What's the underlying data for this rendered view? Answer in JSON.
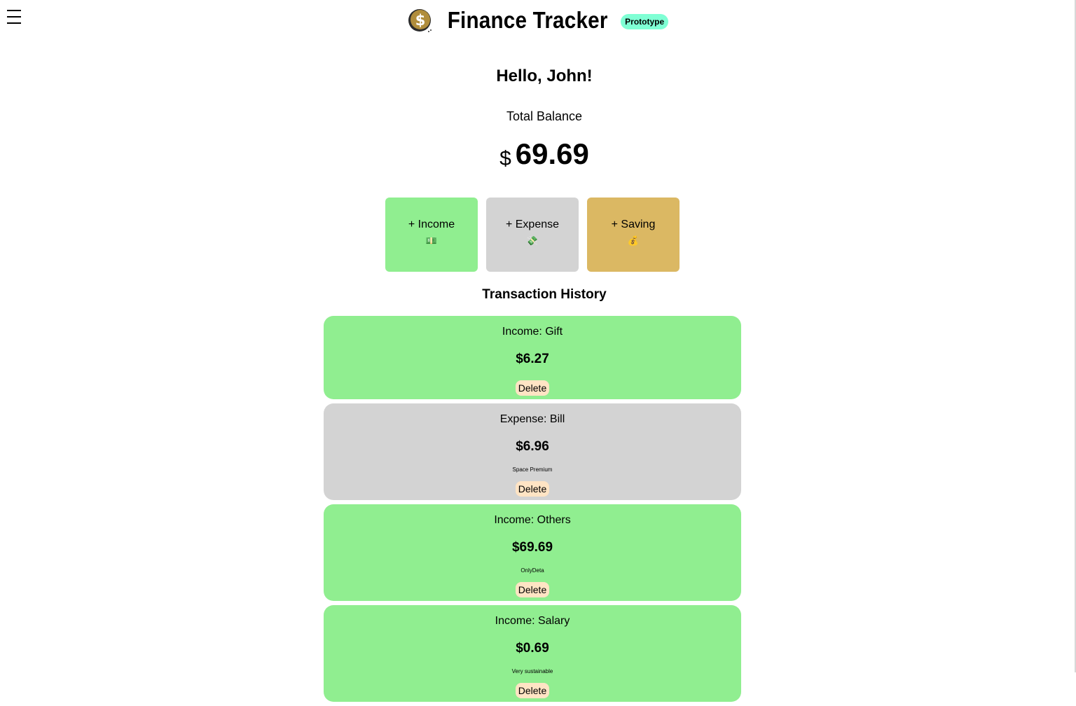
{
  "header": {
    "title": "Finance Tracker",
    "badge": "Prototype",
    "logo_icon": "dollar-coin-icon"
  },
  "greeting": "Hello, John!",
  "balance": {
    "label": "Total Balance",
    "currency": "$",
    "amount": "69.69"
  },
  "actions": [
    {
      "label": "+ Income",
      "emoji": "💵",
      "color": "#90ee90"
    },
    {
      "label": "+ Expense",
      "emoji": "💸",
      "color": "#d3d3d3"
    },
    {
      "label": "+ Saving",
      "emoji": "💰",
      "color": "#dbb863"
    }
  ],
  "history": {
    "title": "Transaction History",
    "transactions": [
      {
        "kind": "Income: Gift",
        "amount": "$6.27",
        "note": "",
        "delete_label": "Delete",
        "color": "#90ee90"
      },
      {
        "kind": "Expense: Bill",
        "amount": "$6.96",
        "note": "Space Premium",
        "delete_label": "Delete",
        "color": "#d3d3d3"
      },
      {
        "kind": "Income: Others",
        "amount": "$69.69",
        "note": "OnlyDeta",
        "delete_label": "Delete",
        "color": "#90ee90"
      },
      {
        "kind": "Income: Salary",
        "amount": "$0.69",
        "note": "Very sustainable",
        "delete_label": "Delete",
        "color": "#90ee90"
      }
    ]
  }
}
